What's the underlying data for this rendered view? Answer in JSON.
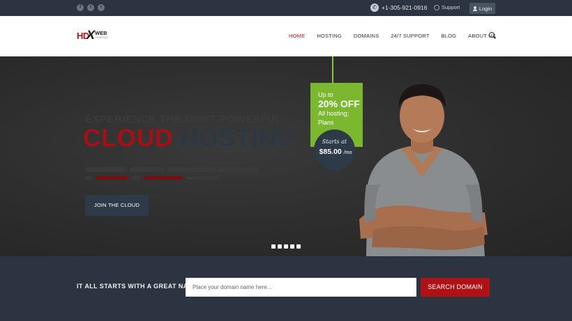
{
  "topbar": {
    "social": [
      {
        "name": "facebook-icon",
        "glyph": "f"
      },
      {
        "name": "twitter-icon",
        "glyph": "t"
      },
      {
        "name": "rss-icon",
        "glyph": "r"
      }
    ],
    "phone": "+1-305-921-0916",
    "support_label": "Support",
    "login_label": "Login"
  },
  "header": {
    "logo": {
      "hd": "HD",
      "x": "X",
      "web": "WEB",
      "hosting": "HOSTING"
    },
    "nav": [
      {
        "label": "HOME",
        "active": true
      },
      {
        "label": "HOSTING",
        "active": false
      },
      {
        "label": "DOMAINS",
        "active": false
      },
      {
        "label": "24/7 SUPPORT",
        "active": false
      },
      {
        "label": "BLOG",
        "active": false
      },
      {
        "label": "ABOUT US",
        "active": false
      }
    ]
  },
  "hero": {
    "kicker": "EXPERIENCE THE MOST POWERFUL",
    "title_part1": "CLOUD",
    "title_part2": "HOSTING",
    "cta_label": "JOIN THE CLOUD",
    "slides_count": 5
  },
  "price_tag": {
    "line1": "Up to",
    "line2": "20% OFF",
    "line3": "All hosting;",
    "line4": "Plans",
    "starts_at": "Starts at",
    "price": "$85.00",
    "period": "/mo"
  },
  "domain_search": {
    "label": "IT ALL STARTS WITH A GREAT NAME:",
    "placeholder": "Place your domain name here...",
    "button_label": "SEARCH DOMAIN"
  },
  "colors": {
    "brand_red": "#b01116",
    "dark_navy": "#2b3440",
    "accent_green": "#7cb82f"
  }
}
